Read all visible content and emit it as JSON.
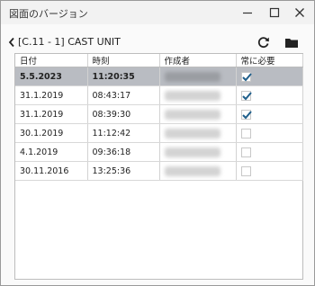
{
  "window": {
    "title": "図面のバージョン"
  },
  "header": {
    "title": "[C.11 - 1] CAST UNIT"
  },
  "table": {
    "columns": [
      "日付",
      "時刻",
      "作成者",
      "常に必要"
    ],
    "rows": [
      {
        "date": "5.5.2023",
        "time": "11:20:35",
        "author": "redacted name",
        "always_required": true,
        "selected": true
      },
      {
        "date": "31.1.2019",
        "time": "08:43:17",
        "author": "redacted name",
        "always_required": true,
        "selected": false
      },
      {
        "date": "31.1.2019",
        "time": "08:39:30",
        "author": "redacted name",
        "always_required": true,
        "selected": false
      },
      {
        "date": "30.1.2019",
        "time": "11:12:42",
        "author": "redacted name",
        "always_required": false,
        "selected": false
      },
      {
        "date": "4.1.2019",
        "time": "09:36:18",
        "author": "redacted name",
        "always_required": false,
        "selected": false
      },
      {
        "date": "30.11.2016",
        "time": "13:25:36",
        "author": "redacted name",
        "always_required": false,
        "selected": false
      }
    ]
  },
  "colors": {
    "selected_row": "#b9bcc2",
    "check": "#1f5f8b"
  },
  "icons": {
    "minimize": "minimize-icon",
    "maximize": "maximize-icon",
    "close": "close-icon",
    "back": "chevron-left-icon",
    "refresh": "refresh-icon",
    "folder": "folder-icon"
  }
}
